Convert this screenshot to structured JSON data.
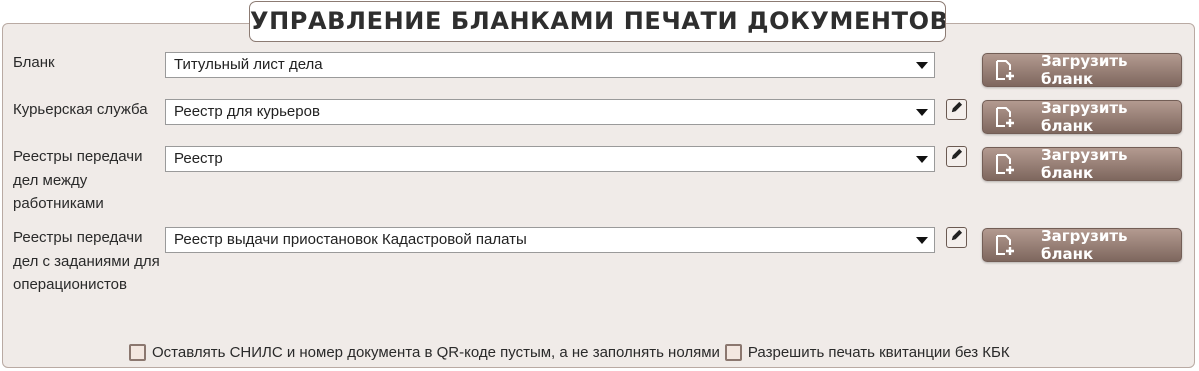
{
  "title": "УПРАВЛЕНИЕ БЛАНКАМИ ПЕЧАТИ ДОКУМЕНТОВ",
  "rows": [
    {
      "label": "Бланк",
      "value": "Титульный лист дела",
      "has_edit": false,
      "button": "Загрузить бланк"
    },
    {
      "label": "Курьерская служба",
      "value": "Реестр для курьеров",
      "has_edit": true,
      "button": "Загрузить бланк"
    },
    {
      "label": "Реестры передачи дел между работниками",
      "value": "Реестр",
      "has_edit": true,
      "button": "Загрузить бланк"
    },
    {
      "label": "Реестры передачи дел с заданиями для операционистов",
      "value": "Реестр выдачи приостановок Кадастровой палаты",
      "has_edit": true,
      "button": "Загрузить бланк"
    }
  ],
  "checkboxes": [
    {
      "label": "Оставлять СНИЛС и номер документа в QR-коде пустым, а не заполнять нолями",
      "checked": false
    },
    {
      "label": "Разрешить печать квитанции без КБК",
      "checked": false
    }
  ],
  "icons": {
    "button": "add-file-icon",
    "edit": "pencil-icon",
    "caret": "caret-down-icon"
  },
  "colors": {
    "panel_bg": "#f0ebe8",
    "button_top": "#b39a90",
    "button_bottom": "#7e675e",
    "checkbox_border": "#8b776f"
  }
}
